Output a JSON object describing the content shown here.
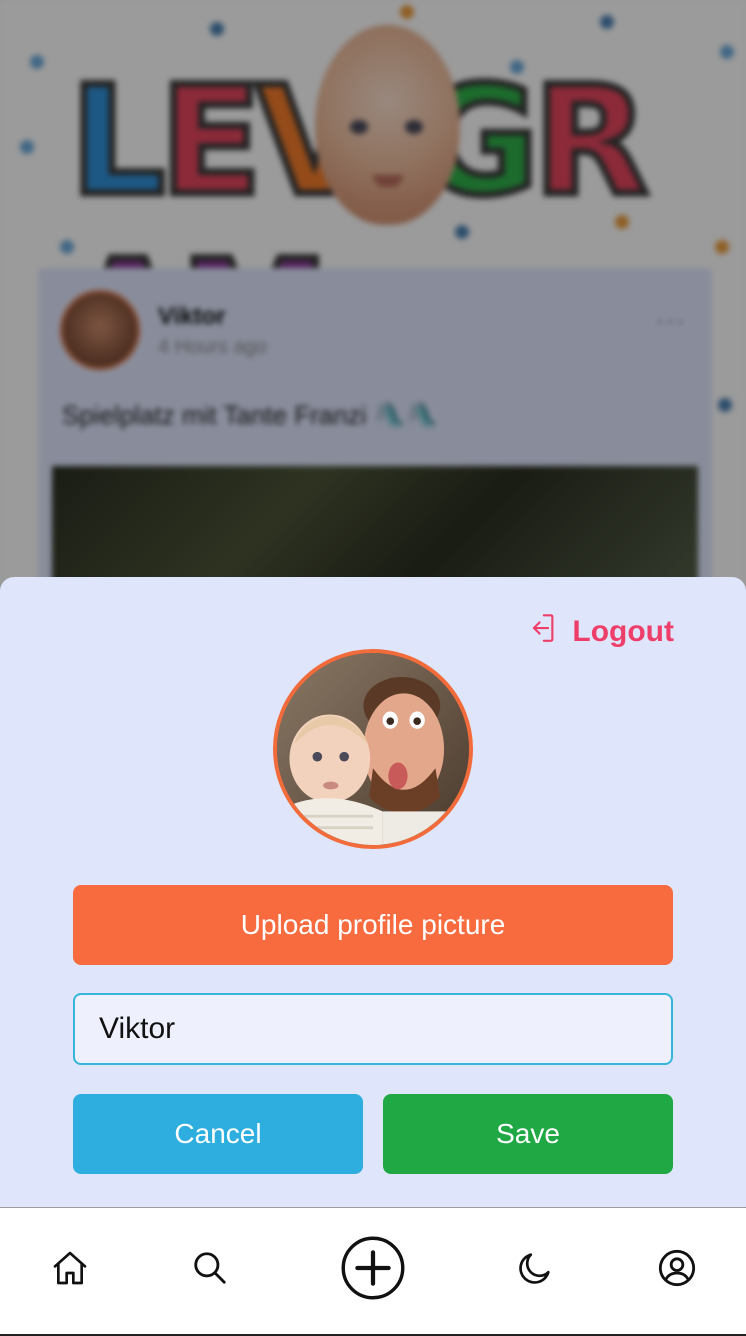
{
  "background": {
    "logo_text": "LEVIGRAM",
    "logo_colors": [
      "#2f8fd6",
      "#e2445c",
      "#f07a2a",
      "#f4b81c",
      "#2fae4a",
      "#e2445c",
      "#8b3a9a",
      "#8b3a9a"
    ],
    "post": {
      "author": "Viktor",
      "time": "4 Hours ago",
      "menu": "···",
      "text": "Spielplatz mit Tante Franzi 🛝🛝"
    }
  },
  "modal": {
    "logout_label": "Logout",
    "upload_label": "Upload profile picture",
    "name_value": "Viktor",
    "cancel_label": "Cancel",
    "save_label": "Save"
  },
  "nav": {
    "items": [
      {
        "icon": "home-icon"
      },
      {
        "icon": "search-icon"
      },
      {
        "icon": "plus-circle-icon"
      },
      {
        "icon": "moon-icon"
      },
      {
        "icon": "user-circle-icon"
      }
    ]
  },
  "colors": {
    "accent_logout": "#ee3f6a",
    "upload": "#f76b3f",
    "cancel": "#2eaedf",
    "save": "#1fa843",
    "sheet_bg": "#dfe5fa",
    "input_border": "#35b5dc"
  }
}
